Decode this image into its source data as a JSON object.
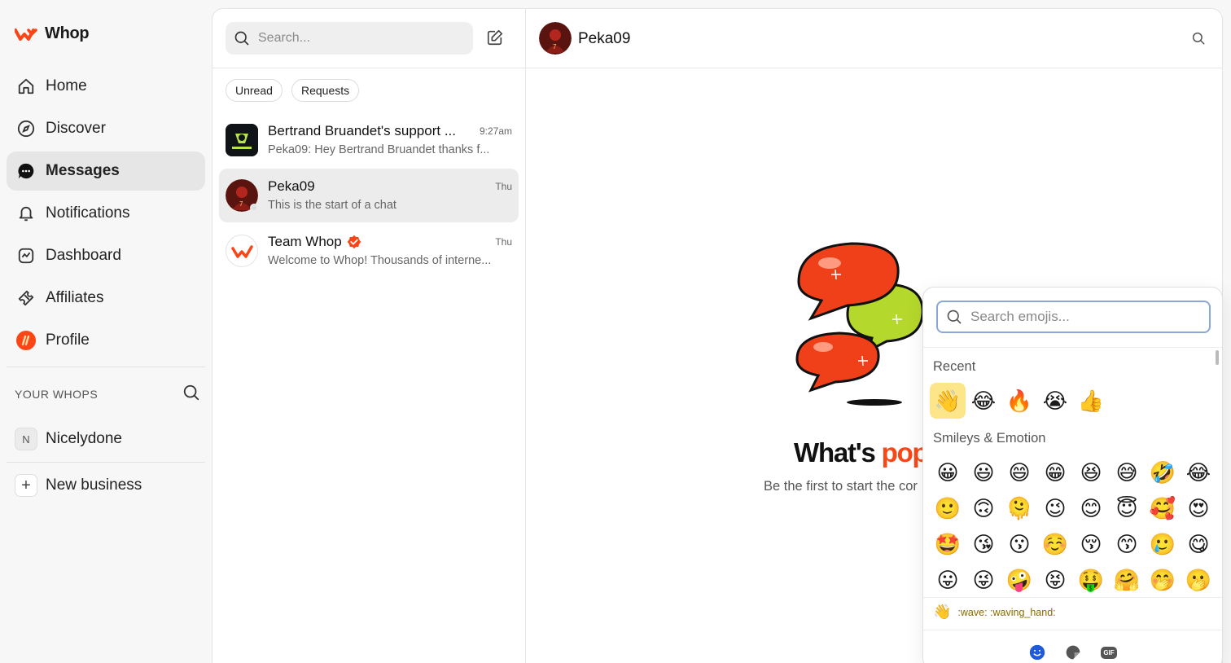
{
  "brand": {
    "name": "Whop",
    "accent": "#fa4616"
  },
  "nav": {
    "items": [
      {
        "label": "Home",
        "icon": "home-icon"
      },
      {
        "label": "Discover",
        "icon": "compass-icon"
      },
      {
        "label": "Messages",
        "icon": "chat-bubble-icon",
        "active": true
      },
      {
        "label": "Notifications",
        "icon": "bell-icon"
      },
      {
        "label": "Dashboard",
        "icon": "chart-icon"
      },
      {
        "label": "Affiliates",
        "icon": "ticket-icon"
      },
      {
        "label": "Profile",
        "icon": "profile-avatar-icon"
      }
    ],
    "section_label": "YOUR WHOPS",
    "whops": [
      {
        "initial": "N",
        "name": "Nicelydone"
      }
    ],
    "new_business": "New business"
  },
  "messages": {
    "search_placeholder": "Search...",
    "filters": [
      "Unread",
      "Requests"
    ],
    "conversations": [
      {
        "name": "Bertrand Bruandet's support ...",
        "time": "9:27am",
        "preview": "Peka09: Hey Bertrand Bruandet thanks f..."
      },
      {
        "name": "Peka09",
        "time": "Thu",
        "preview": "This is the start of a chat",
        "active": true
      },
      {
        "name": "Team Whop",
        "time": "Thu",
        "preview": "Welcome to Whop! Thousands of interne...",
        "verified": true
      }
    ]
  },
  "chat": {
    "title": "Peka09",
    "empty_title_a": "What's",
    "empty_title_b": "pop",
    "empty_sub": "Be the first to start the cor"
  },
  "emoji_picker": {
    "search_placeholder": "Search emojis...",
    "recent_label": "Recent",
    "recent": [
      "👋",
      "😂",
      "🔥",
      "😭",
      "👍"
    ],
    "smileys_label": "Smileys & Emotion",
    "smileys": [
      "😀",
      "😃",
      "😄",
      "😁",
      "😆",
      "😅",
      "🤣",
      "😂",
      "🙂",
      "🙃",
      "🫠",
      "😉",
      "😊",
      "😇",
      "🥰",
      "😍",
      "🤩",
      "😘",
      "😗",
      "☺️",
      "😚",
      "😙",
      "🥲",
      "😋",
      "😛",
      "😜",
      "🤪",
      "😝",
      "🤑",
      "🤗",
      "🤭",
      "🫢"
    ],
    "preview_emoji": "👋",
    "preview_text": ":wave: :waving_hand:",
    "tabs": [
      "emoji-tab",
      "sticker-tab",
      "GIF"
    ]
  }
}
